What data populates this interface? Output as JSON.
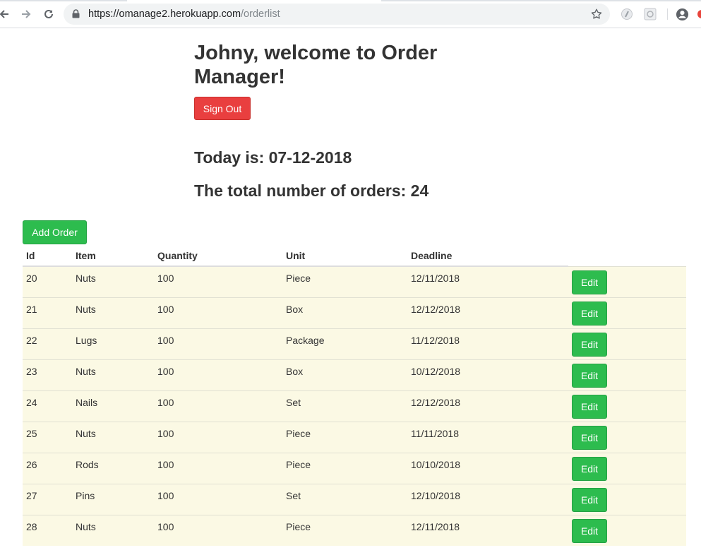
{
  "browser": {
    "url_host": "https://omanage2.herokuapp.com",
    "url_path": "/orderlist"
  },
  "header": {
    "welcome": "Johny, welcome to Order Manager!",
    "sign_out_label": "Sign Out",
    "today": "Today is: 07-12-2018",
    "total_orders": "The total number of orders: 24"
  },
  "toolbar": {
    "add_order_label": "Add Order"
  },
  "table": {
    "columns": [
      "Id",
      "Item",
      "Quantity",
      "Unit",
      "Deadline"
    ],
    "edit_label": "Edit",
    "rows": [
      {
        "id": "20",
        "item": "Nuts",
        "quantity": "100",
        "unit": "Piece",
        "deadline": "12/11/2018"
      },
      {
        "id": "21",
        "item": "Nuts",
        "quantity": "100",
        "unit": "Box",
        "deadline": "12/12/2018"
      },
      {
        "id": "22",
        "item": "Lugs",
        "quantity": "100",
        "unit": "Package",
        "deadline": "11/12/2018"
      },
      {
        "id": "23",
        "item": "Nuts",
        "quantity": "100",
        "unit": "Box",
        "deadline": "10/12/2018"
      },
      {
        "id": "24",
        "item": "Nails",
        "quantity": "100",
        "unit": "Set",
        "deadline": "12/12/2018"
      },
      {
        "id": "25",
        "item": "Nuts",
        "quantity": "100",
        "unit": "Piece",
        "deadline": "11/11/2018"
      },
      {
        "id": "26",
        "item": "Rods",
        "quantity": "100",
        "unit": "Piece",
        "deadline": "10/10/2018"
      },
      {
        "id": "27",
        "item": "Pins",
        "quantity": "100",
        "unit": "Set",
        "deadline": "12/10/2018"
      },
      {
        "id": "28",
        "item": "Nuts",
        "quantity": "100",
        "unit": "Piece",
        "deadline": "12/11/2018"
      }
    ]
  },
  "colors": {
    "danger": "#e93f3f",
    "success": "#2dbc4e",
    "row_background": "#fbf9e4"
  }
}
